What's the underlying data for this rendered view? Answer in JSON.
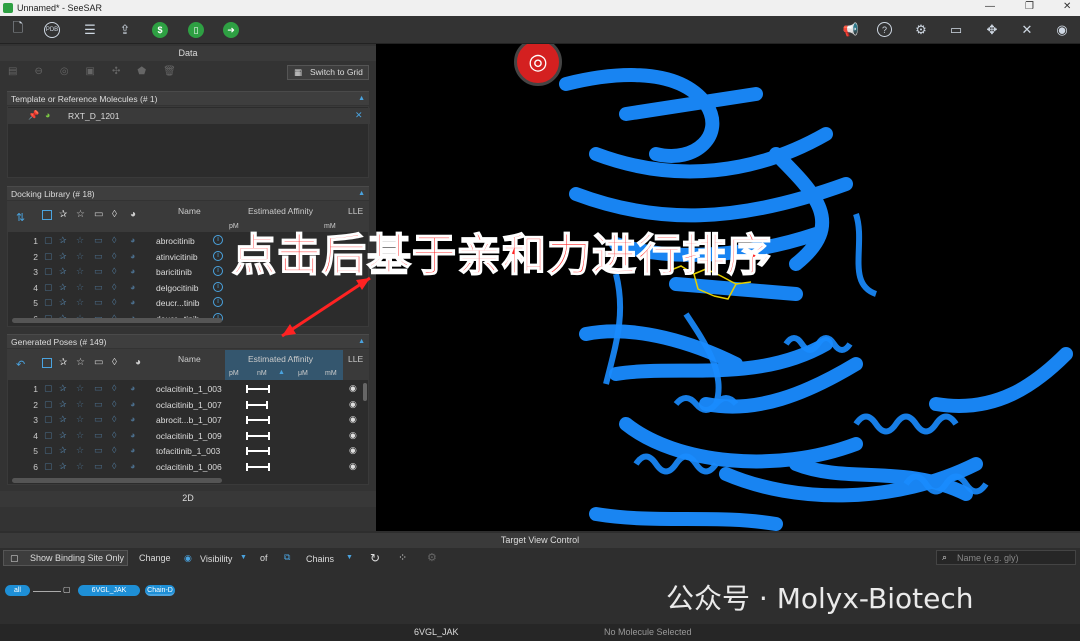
{
  "window": {
    "title": "Unnamed* - SeeSAR"
  },
  "toolbar": {
    "icons": [
      "file-icon",
      "pdb-icon",
      "settings-sliders-icon",
      "upload-icon",
      "s-circle-icon",
      "tablet-circle-icon",
      "arrow-circle-icon"
    ],
    "right_icons": [
      "megaphone-icon",
      "help-icon",
      "gear-icon",
      "monitor-icon",
      "tools-icon",
      "crossed-tools-icon",
      "eye-icon"
    ]
  },
  "data_panel": {
    "header": "Data",
    "switch_label": "Switch to Grid",
    "template_section": {
      "title": "Template or Reference Molecules",
      "count": "(# 1)",
      "molecule": "RXT_D_1201"
    },
    "docking_section": {
      "title": "Docking Library",
      "count": "(# 18)",
      "col_name": "Name",
      "col_affinity": "Estimated Affinity",
      "col_lle": "LLE",
      "unit_pm": "pM",
      "unit_mm": "mM",
      "rows": [
        {
          "n": "1",
          "name": "abrocitinib"
        },
        {
          "n": "2",
          "name": "atinvicitinib"
        },
        {
          "n": "3",
          "name": "baricitinib"
        },
        {
          "n": "4",
          "name": "delgocitinib"
        },
        {
          "n": "5",
          "name": "deucr...tinib"
        },
        {
          "n": "6",
          "name": "deucr...tinib"
        }
      ]
    },
    "poses_section": {
      "title": "Generated Poses",
      "count": "(# 149)",
      "col_name": "Name",
      "col_affinity": "Estimated Affinity",
      "col_lle": "LLE",
      "unit_pm": "pM",
      "unit_nm": "nM",
      "unit_um": "μM",
      "unit_mm": "mM",
      "rows": [
        {
          "n": "1",
          "name": "oclacitinib_1_003"
        },
        {
          "n": "2",
          "name": "oclacitinib_1_007"
        },
        {
          "n": "3",
          "name": "abrocit...b_1_007"
        },
        {
          "n": "4",
          "name": "oclacitinib_1_009"
        },
        {
          "n": "5",
          "name": "tofacitinib_1_003"
        },
        {
          "n": "6",
          "name": "oclacitinib_1_006"
        }
      ]
    },
    "twod_label": "2D"
  },
  "annotation": {
    "text": "点击后基于亲和力进行排序"
  },
  "target_view": {
    "header": "Target View Control",
    "show_binding": "Show Binding Site Only",
    "change": "Change",
    "visibility": "Visibility",
    "of": "of",
    "chains": "Chains",
    "search_placeholder": "Name (e.g. gly)",
    "pill_all": "all",
    "pill_struct": "6VGL_JAK",
    "pill_chain": "Chain-D"
  },
  "statusbar": {
    "structure": "6VGL_JAK",
    "selection": "No Molecule Selected"
  },
  "watermark": {
    "text": "公众号 · Molyx-Biotech"
  },
  "colors": {
    "accent": "#1e8fd6",
    "protein": "#1a8cff",
    "annotation": "#ff2222",
    "logo": "#d42020"
  }
}
